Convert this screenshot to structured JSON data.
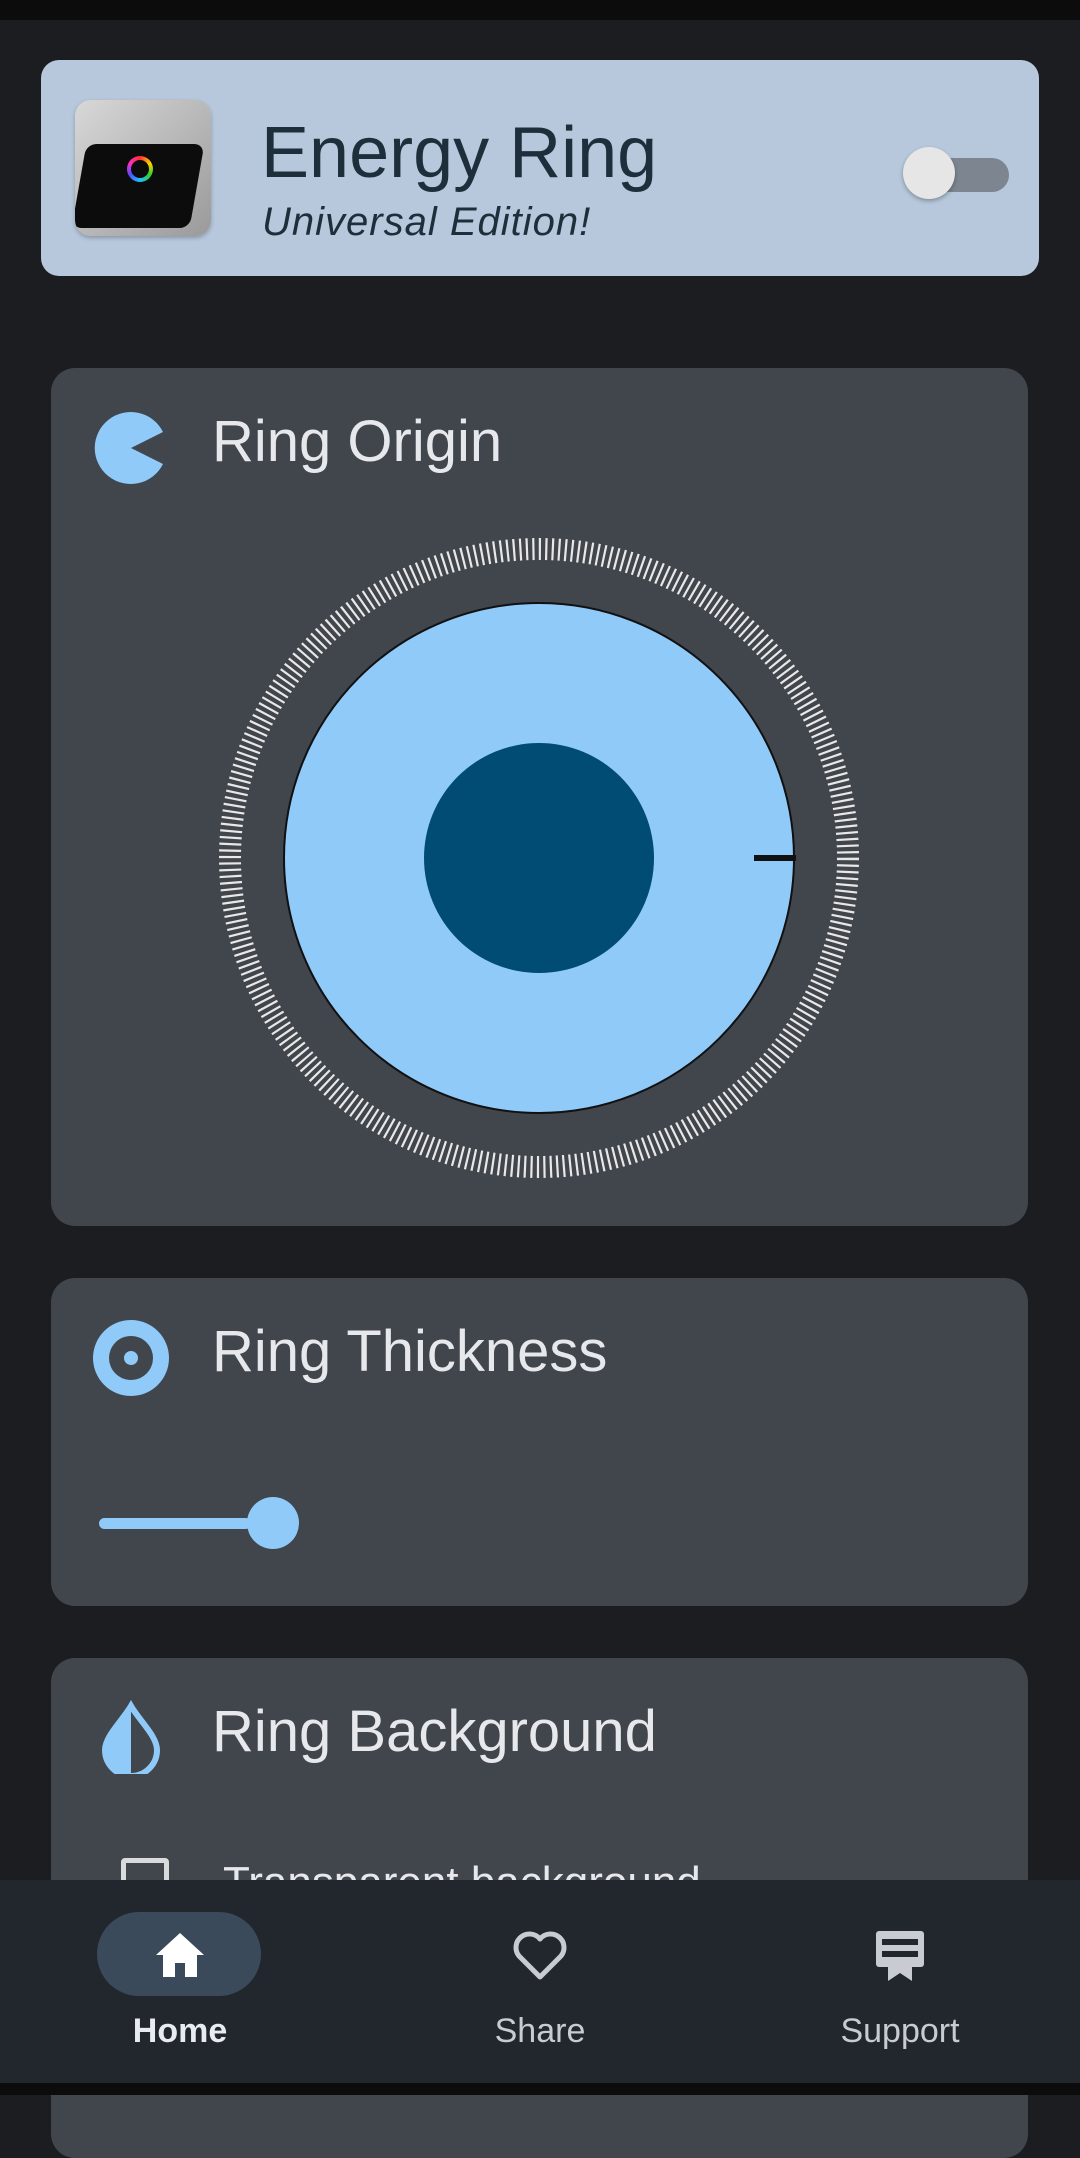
{
  "app": {
    "title": "Energy Ring",
    "subtitle": "Universal Edition!",
    "icon": "energy-ring-app-icon",
    "master_toggle_on": false
  },
  "sections": {
    "origin": {
      "title": "Ring Origin",
      "icon": "pie-origin-icon",
      "handle_angle_deg": 0
    },
    "thickness": {
      "title": "Ring Thickness",
      "icon": "ring-target-icon",
      "slider_fraction": 0.06
    },
    "background": {
      "title": "Ring Background",
      "icon": "water-drop-icon",
      "checkbox_label": "Transparent background",
      "checkbox_checked": false
    }
  },
  "nav": {
    "items": [
      {
        "label": "Home",
        "icon": "home-icon",
        "active": true
      },
      {
        "label": "Share",
        "icon": "heart-icon",
        "active": false
      },
      {
        "label": "Support",
        "icon": "support-icon",
        "active": false
      }
    ]
  },
  "colors": {
    "accent": "#90caf9",
    "accent_dark": "#004c75",
    "header_bg": "#b7c8dc",
    "card_bg": "#41454c",
    "background": "#1c1d20"
  }
}
